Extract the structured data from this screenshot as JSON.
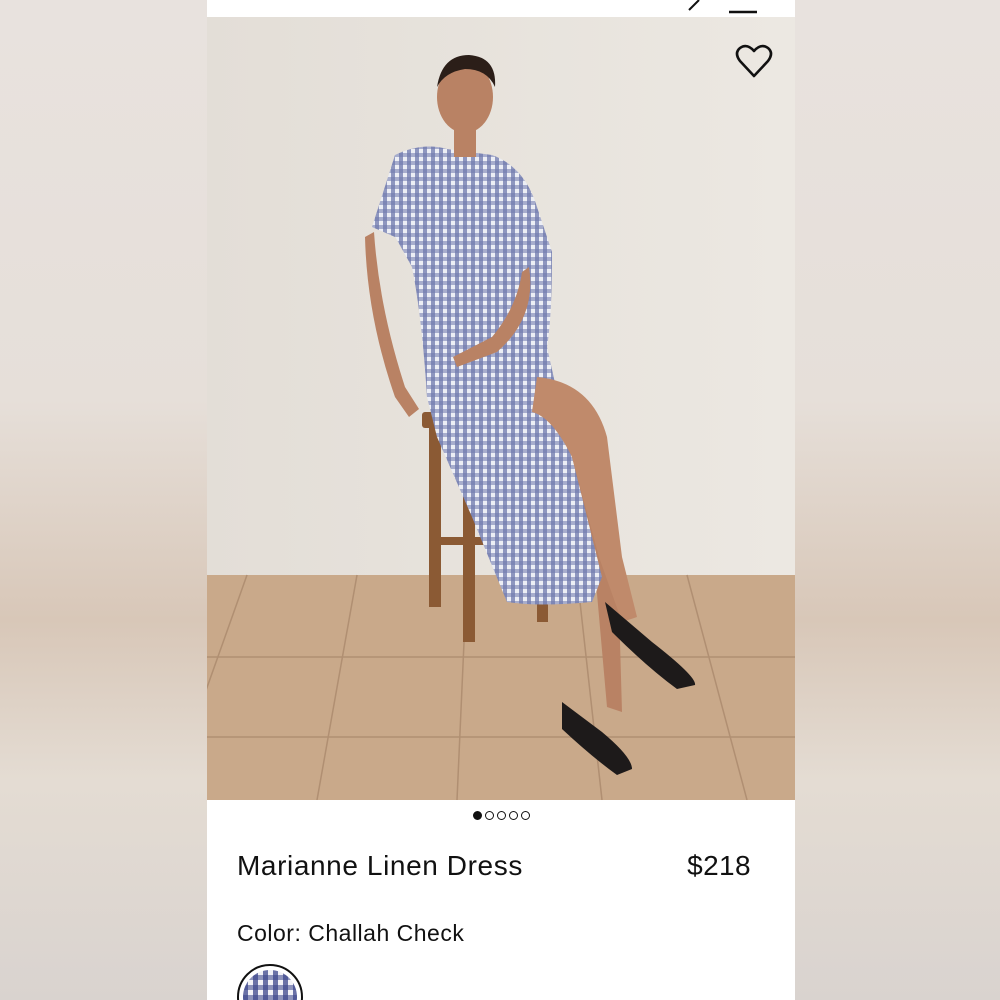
{
  "product": {
    "name": "Marianne Linen Dress",
    "price": "$218",
    "color_label": "Color:",
    "color_value": "Challah Check"
  },
  "carousel": {
    "total_images": 5,
    "active_index": 0
  },
  "icons": {
    "wishlist": "heart-outline-icon",
    "swatch": "gingham-swatch"
  },
  "colors": {
    "text": "#111111",
    "background": "#ffffff",
    "wall": "#e9e4de",
    "floor": "#c9a98a",
    "dress": "#6f78ad"
  }
}
